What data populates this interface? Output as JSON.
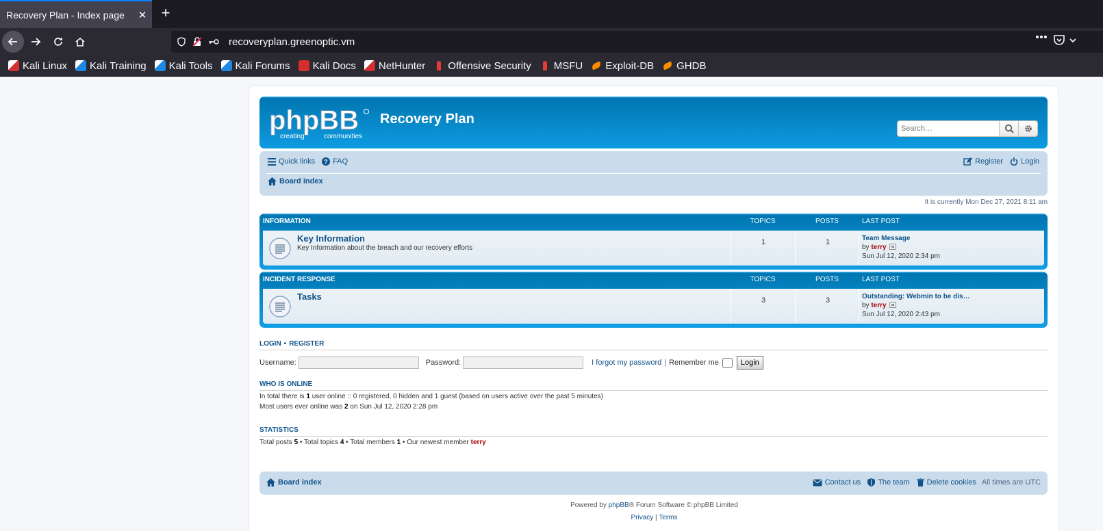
{
  "browser": {
    "tab_title": "Recovery Plan - Index page",
    "tab_close": "✕",
    "new_tab": "+",
    "url": "recoveryplan.greenoptic.vm",
    "bookmarks": [
      {
        "label": "Kali Linux",
        "icon": "kali-dragon-icon"
      },
      {
        "label": "Kali Training",
        "icon": "kali-training-icon"
      },
      {
        "label": "Kali Tools",
        "icon": "kali-tools-icon"
      },
      {
        "label": "Kali Forums",
        "icon": "kali-forums-icon"
      },
      {
        "label": "Kali Docs",
        "icon": "kali-docs-icon"
      },
      {
        "label": "NetHunter",
        "icon": "nethunter-icon"
      },
      {
        "label": "Offensive Security",
        "icon": "offsec-icon"
      },
      {
        "label": "MSFU",
        "icon": "msfu-icon"
      },
      {
        "label": "Exploit-DB",
        "icon": "exploitdb-icon"
      },
      {
        "label": "GHDB",
        "icon": "ghdb-icon"
      }
    ]
  },
  "forum": {
    "site_title": "Recovery Plan",
    "logo_text": "phpBB",
    "logo_sub_left": "creating",
    "logo_sub_right": "communities",
    "search_placeholder": "Search…",
    "nav": {
      "quick_links": "Quick links",
      "faq": "FAQ",
      "register": "Register",
      "login": "Login",
      "board_index": "Board index"
    },
    "current_time": "It is currently Mon Dec 27, 2021 8:11 am",
    "col_topics": "TOPICS",
    "col_posts": "POSTS",
    "col_last_post": "LAST POST",
    "categories": [
      {
        "name": "INFORMATION",
        "forum_title": "Key Information",
        "forum_desc": "Key Information about the breach and our recovery efforts",
        "topics": "1",
        "posts": "1",
        "last_title": "Team Message",
        "by": "by",
        "last_user": "terry",
        "last_time": "Sun Jul 12, 2020 2:34 pm"
      },
      {
        "name": "INCIDENT RESPONSE",
        "forum_title": "Tasks",
        "forum_desc": "",
        "topics": "3",
        "posts": "3",
        "last_title": "Outstanding: Webmin to be dis…",
        "by": "by",
        "last_user": "terry",
        "last_time": "Sun Jul 12, 2020 2:43 pm"
      }
    ],
    "login_section": {
      "login": "LOGIN",
      "sep": "•",
      "register": "REGISTER",
      "username_label": "Username:",
      "password_label": "Password:",
      "forgot": "I forgot my password",
      "bar": "|",
      "remember": "Remember me",
      "button": "Login"
    },
    "online": {
      "title": "WHO IS ONLINE",
      "line1_a": "In total there is ",
      "line1_count": "1",
      "line1_b": " user online :: 0 registered, 0 hidden and 1 guest (based on users active over the past 5 minutes)",
      "line2_a": "Most users ever online was ",
      "line2_count": "2",
      "line2_b": " on Sun Jul 12, 2020 2:28 pm"
    },
    "stats": {
      "title": "STATISTICS",
      "posts_label": "Total posts ",
      "posts": "5",
      "topics_label": " • Total topics ",
      "topics": "4",
      "members_label": " • Total members ",
      "members": "1",
      "newest_label": " • Our newest member ",
      "newest": "terry"
    },
    "footer": {
      "board_index": "Board index",
      "contact": "Contact us",
      "team": "The team",
      "delete_cookies": "Delete cookies",
      "timezone": "All times are UTC",
      "powered_a": "Powered by ",
      "powered_link": "phpBB",
      "powered_b": "® Forum Software © phpBB Limited",
      "privacy": "Privacy",
      "pipe": " | ",
      "terms": "Terms"
    }
  },
  "colors": {
    "header_blue": "#12a3eb",
    "link_blue": "#105289",
    "user_red": "#aa0000",
    "navbar_bg": "#cadceb"
  }
}
